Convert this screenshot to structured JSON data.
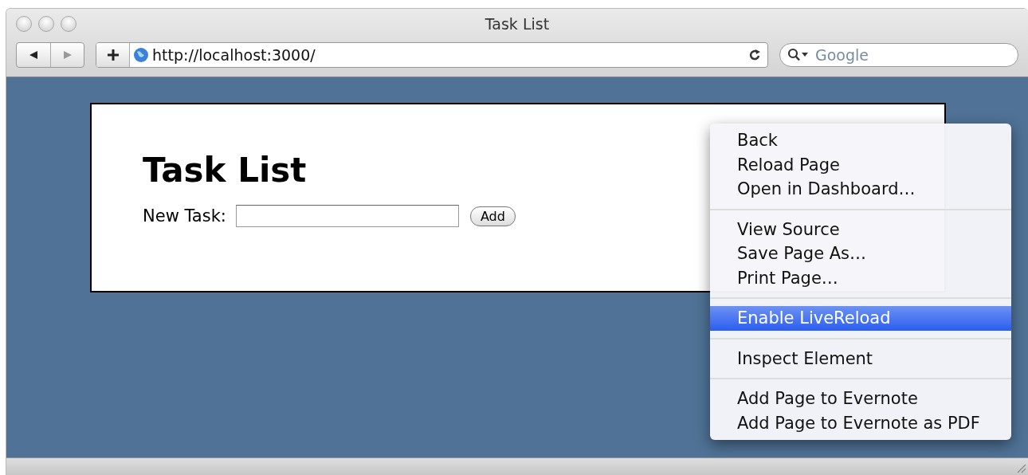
{
  "window": {
    "title": "Task List"
  },
  "toolbar": {
    "url": "http://localhost:3000/",
    "search": {
      "placeholder": "Google"
    }
  },
  "page": {
    "heading": "Task List",
    "field_label": "New Task:",
    "add_button": "Add"
  },
  "context_menu": {
    "groups": [
      [
        {
          "label": "Back",
          "selected": false
        },
        {
          "label": "Reload Page",
          "selected": false
        },
        {
          "label": "Open in Dashboard…",
          "selected": false
        }
      ],
      [
        {
          "label": "View Source",
          "selected": false
        },
        {
          "label": "Save Page As…",
          "selected": false
        },
        {
          "label": "Print Page…",
          "selected": false
        }
      ],
      [
        {
          "label": "Enable LiveReload",
          "selected": true
        }
      ],
      [
        {
          "label": "Inspect Element",
          "selected": false
        }
      ],
      [
        {
          "label": "Add Page to Evernote",
          "selected": false
        },
        {
          "label": "Add Page to Evernote as PDF",
          "selected": false
        }
      ]
    ]
  }
}
